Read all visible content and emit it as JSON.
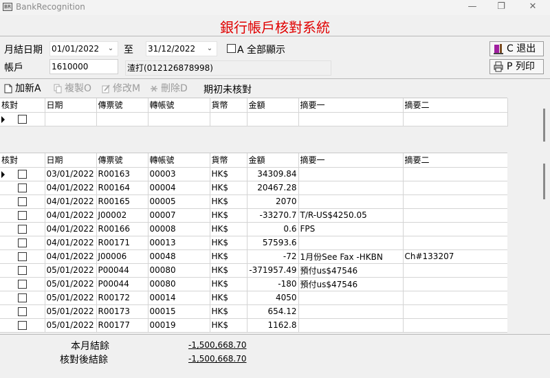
{
  "window": {
    "title": "BankRecognition",
    "app_icon_text": "BR",
    "minimize": "—",
    "maximize": "❐",
    "close": "✕"
  },
  "system_title": "銀行帳戶核對系統",
  "filter": {
    "month_end_label": "月結日期",
    "date_from": "01/01/2022",
    "to_label": "至",
    "date_to": "31/12/2022",
    "show_all_label": "A 全部顯示",
    "account_label": "帳戶",
    "account_no": "1610000",
    "account_desc": "渣打(012126878998)"
  },
  "buttons": {
    "exit": "C 退出",
    "print": "P 列印"
  },
  "toolbar": {
    "add": "加新A",
    "copy": "複製O",
    "edit": "修改M",
    "delete": "刪除D",
    "section_title": "期初未核對"
  },
  "columns": [
    "核對",
    "日期",
    "傳票號",
    "轉帳號",
    "貨幣",
    "金額",
    "摘要一",
    "摘要二"
  ],
  "rows": [
    [
      "03/01/2022",
      "R00163",
      "00003",
      "HK$",
      "34309.84",
      "",
      ""
    ],
    [
      "04/01/2022",
      "R00164",
      "00004",
      "HK$",
      "20467.28",
      "",
      ""
    ],
    [
      "04/01/2022",
      "R00165",
      "00005",
      "HK$",
      "2070",
      "",
      ""
    ],
    [
      "04/01/2022",
      "J00002",
      "00007",
      "HK$",
      "-33270.7",
      "T/R-US$4250.05",
      ""
    ],
    [
      "04/01/2022",
      "R00166",
      "00008",
      "HK$",
      "0.6",
      "FPS",
      ""
    ],
    [
      "04/01/2022",
      "R00171",
      "00013",
      "HK$",
      "57593.6",
      "",
      ""
    ],
    [
      "04/01/2022",
      "J00006",
      "00048",
      "HK$",
      "-72",
      "1月份See Fax -HKBN",
      "Ch#133207"
    ],
    [
      "05/01/2022",
      "P00044",
      "00080",
      "HK$",
      "-371957.49",
      "預付us$47546",
      ""
    ],
    [
      "05/01/2022",
      "P00044",
      "00080",
      "HK$",
      "-180",
      "預付us$47546",
      ""
    ],
    [
      "05/01/2022",
      "R00172",
      "00014",
      "HK$",
      "4050",
      "",
      ""
    ],
    [
      "05/01/2022",
      "R00173",
      "00015",
      "HK$",
      "654.12",
      "",
      ""
    ],
    [
      "05/01/2022",
      "R00177",
      "00019",
      "HK$",
      "1162.8",
      "",
      ""
    ]
  ],
  "totals": {
    "month_balance_label": "本月結餘",
    "month_balance": "-1,500,668.70",
    "reconciled_balance_label": "核對後結餘",
    "reconciled_balance": "-1,500,668.70"
  },
  "colors": {
    "title_red": "#e00000",
    "disabled_text": "#9c9c9c"
  }
}
